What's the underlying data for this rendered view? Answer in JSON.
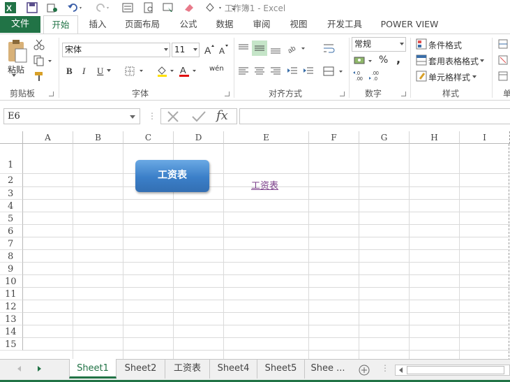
{
  "window": {
    "title": "工作簿1 - Excel"
  },
  "tabs": [
    "文件",
    "开始",
    "插入",
    "页面布局",
    "公式",
    "数据",
    "审阅",
    "视图",
    "开发工具",
    "POWER VIEW"
  ],
  "clipboard": {
    "paste": "粘贴",
    "label": "剪贴板"
  },
  "font": {
    "name": "宋体",
    "size": "11",
    "bold": "B",
    "italic": "I",
    "underline": "U",
    "label": "字体",
    "phonetic": "wén"
  },
  "alignment": {
    "label": "对齐方式"
  },
  "number": {
    "format": "常规",
    "percent": "%",
    "comma": ",",
    "label": "数字"
  },
  "styles": {
    "conditional": "条件格式",
    "table": "套用表格格式",
    "cell": "单元格样式",
    "label": "样式",
    "cells_partial": "单"
  },
  "formula_bar": {
    "namebox": "E6",
    "fx": "fx",
    "value": ""
  },
  "columns": [
    "A",
    "B",
    "C",
    "D",
    "E",
    "F",
    "G",
    "H",
    "I"
  ],
  "rows": [
    "1",
    "2",
    "3",
    "4",
    "5",
    "6",
    "7",
    "8",
    "9",
    "10",
    "11",
    "12",
    "13",
    "14",
    "15"
  ],
  "cells": {
    "E2": "工资表"
  },
  "shape_button": {
    "label": "工资表"
  },
  "sheets": [
    "Sheet1",
    "Sheet2",
    "工资表",
    "Sheet4",
    "Sheet5",
    "Shee ..."
  ],
  "colors": {
    "accent": "#217346",
    "shape": "#3b7fc8",
    "hyperlink": "#7b3f8a"
  }
}
